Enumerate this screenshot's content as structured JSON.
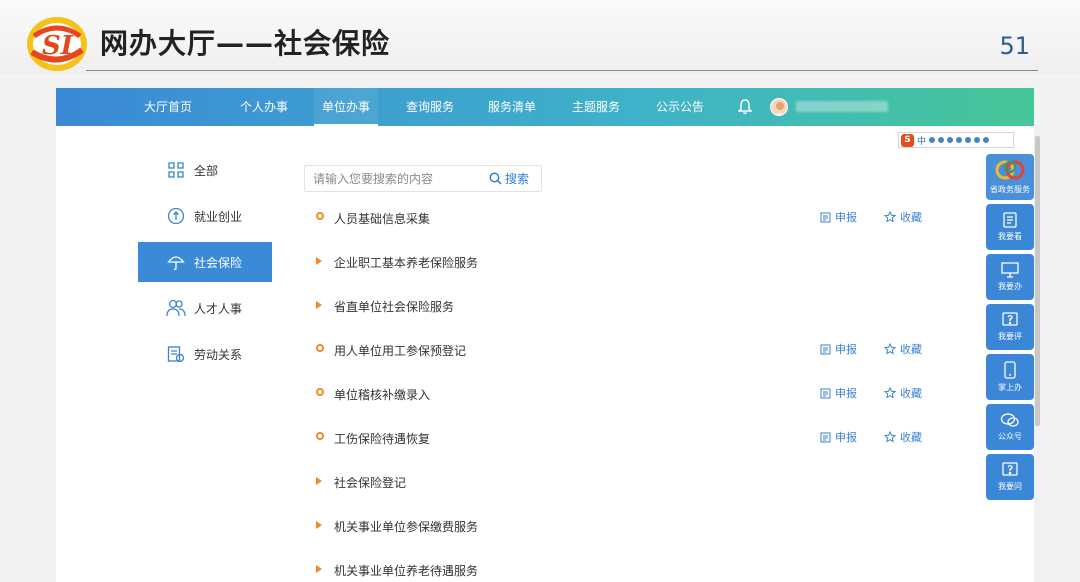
{
  "slide": {
    "title": "网办大厅——社会保险",
    "page_number": "51",
    "logo_text": "SI"
  },
  "nav": {
    "items": [
      "大厅首页",
      "个人办事",
      "单位办事",
      "查询服务",
      "服务清单",
      "主题服务",
      "公示公告"
    ],
    "active_index": 2
  },
  "sidebar": {
    "items": [
      {
        "label": "全部",
        "icon": "grid-icon"
      },
      {
        "label": "就业创业",
        "icon": "medal-icon"
      },
      {
        "label": "社会保险",
        "icon": "umbrella-icon"
      },
      {
        "label": "人才人事",
        "icon": "people-icon"
      },
      {
        "label": "劳动关系",
        "icon": "contract-icon"
      }
    ],
    "active_index": 2
  },
  "search": {
    "placeholder": "请输入您要搜索的内容",
    "button_label": "搜索"
  },
  "services": [
    {
      "label": "人员基础信息采集",
      "marker": "circle",
      "apply": "申报",
      "favorite": "收藏"
    },
    {
      "label": "企业职工基本养老保险服务",
      "marker": "triangle"
    },
    {
      "label": "省直单位社会保险服务",
      "marker": "triangle"
    },
    {
      "label": "用人单位用工参保预登记",
      "marker": "circle",
      "apply": "申报",
      "favorite": "收藏"
    },
    {
      "label": "单位稽核补缴录入",
      "marker": "circle",
      "apply": "申报",
      "favorite": "收藏"
    },
    {
      "label": "工伤保险待遇恢复",
      "marker": "circle",
      "apply": "申报",
      "favorite": "收藏"
    },
    {
      "label": "社会保险登记",
      "marker": "triangle"
    },
    {
      "label": "机关事业单位参保缴费服务",
      "marker": "triangle"
    },
    {
      "label": "机关事业单位养老待遇服务",
      "marker": "triangle"
    }
  ],
  "float_menu": [
    {
      "label": "省政务服务",
      "icon": "logo-icon"
    },
    {
      "label": "我要看",
      "icon": "document-icon"
    },
    {
      "label": "我要办",
      "icon": "monitor-icon"
    },
    {
      "label": "我要评",
      "icon": "question-icon"
    },
    {
      "label": "掌上办",
      "icon": "phone-icon"
    },
    {
      "label": "公众号",
      "icon": "wechat-icon"
    },
    {
      "label": "我要问",
      "icon": "question-icon"
    }
  ],
  "sogou_toolbar": {
    "logo": "S",
    "lang": "中"
  },
  "colors": {
    "nav_start": "#3b89d6",
    "nav_end": "#46c797",
    "accent": "#3a8ad8",
    "marker": "#f08a24"
  }
}
